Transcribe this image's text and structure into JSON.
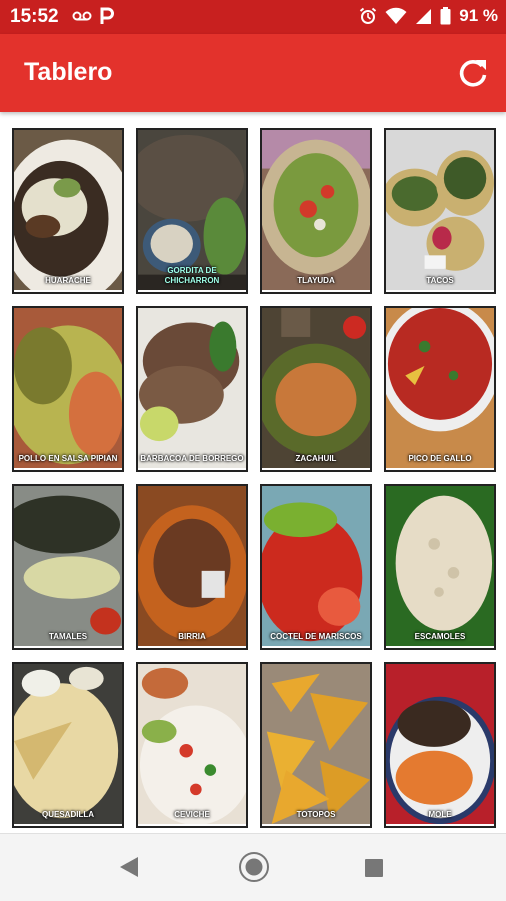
{
  "status_bar": {
    "time": "15:52",
    "battery_percent": "91 %",
    "left_icons": [
      "voicemail-icon",
      "parking-p-icon"
    ],
    "right_icons": [
      "alarm-icon",
      "wifi-icon",
      "signal-icon",
      "battery-icon"
    ]
  },
  "app_bar": {
    "title": "Tablero",
    "action_icon": "refresh-icon",
    "color": "#e3322c",
    "status_color": "#c8201f"
  },
  "tiles": [
    {
      "label": "HUARACHE"
    },
    {
      "label": "GORDITA DE CHICHARRON"
    },
    {
      "label": "TLAYUDA"
    },
    {
      "label": "TACOS"
    },
    {
      "label": "POLLO EN SALSA PIPIAN"
    },
    {
      "label": "BARBACOA DE BORREGO"
    },
    {
      "label": "ZACAHUIL"
    },
    {
      "label": "PICO DE GALLO"
    },
    {
      "label": "TAMALES"
    },
    {
      "label": "BIRRIA"
    },
    {
      "label": "COCTEL DE MARISCOS"
    },
    {
      "label": "ESCAMOLES"
    },
    {
      "label": "QUESADILLA"
    },
    {
      "label": "CEVICHE"
    },
    {
      "label": "TOTOPOS"
    },
    {
      "label": "MOLE"
    }
  ],
  "nav_bar": {
    "icons": [
      "back-triangle-icon",
      "home-circle-icon",
      "recent-apps-square-icon"
    ]
  }
}
